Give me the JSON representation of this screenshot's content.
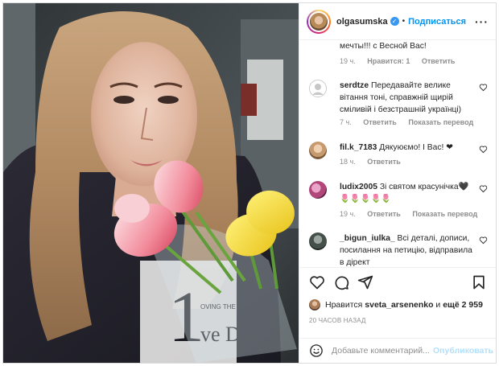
{
  "header": {
    "username": "olgasumska",
    "separator": "•",
    "follow_label": "Подписаться",
    "more_label": "···",
    "verified_mark": "✓"
  },
  "comments": [
    {
      "username": "",
      "text": "мечты!!! с Весной Вас!",
      "time": "19 ч.",
      "likes": "Нравится: 1",
      "reply": "Ответить",
      "translate": ""
    },
    {
      "username": "serdtze",
      "text": "Передавайте велике вітання тоні, справжній щирій сміливій і безстрашній українці)",
      "time": "7 ч.",
      "likes": "",
      "reply": "Ответить",
      "translate": "Показать перевод"
    },
    {
      "username": "fil.k_7183",
      "text": "Дякуюємо! I Вас! ❤",
      "time": "18 ч.",
      "likes": "",
      "reply": "Ответить",
      "translate": ""
    },
    {
      "username": "ludix2005",
      "text": "Зі святом красунічка🖤 🌷🌷🌷🌷🌷",
      "time": "19 ч.",
      "likes": "",
      "reply": "Ответить",
      "translate": "Показать перевод"
    },
    {
      "username": "_bigun_iulka_",
      "text": "Всі деталі, дописи, посилання на петицію, відправила в дірект",
      "time": "",
      "likes": "",
      "reply": "",
      "translate": ""
    }
  ],
  "likes": {
    "prefix": "Нравится",
    "user": "sveta_arsenenko",
    "middle": "и",
    "rest": "ещё 2 959"
  },
  "timestamp": "20 ЧАСОВ НАЗАД",
  "add_comment": {
    "placeholder": "Добавьте комментарий...",
    "publish_label": "Опубликовать"
  },
  "photo": {
    "shirt_text": "OVING THE",
    "shirt_number": "1",
    "shirt_word": "ve D"
  },
  "colors": {
    "link": "#0095f6",
    "publish_disabled": "#b2dffc",
    "muted": "#8e8e8e",
    "verified": "#3897f0",
    "heart_red": "#ed4956"
  },
  "icons": [
    "verified-icon",
    "more-icon",
    "heart-icon",
    "comment-icon",
    "share-icon",
    "bookmark-icon",
    "emoji-icon"
  ]
}
